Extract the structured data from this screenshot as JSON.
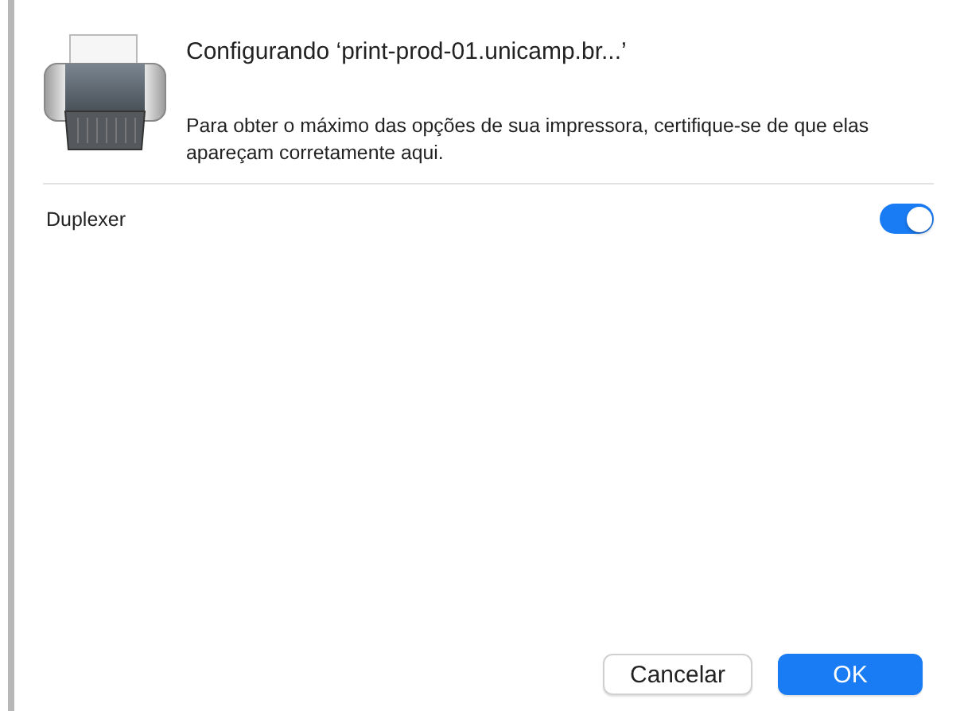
{
  "dialog": {
    "title": "Configurando ‘print-prod-01.unicamp.br...’",
    "description": "Para obter o máximo das opções de sua impressora, certifique-se de que elas apareçam corretamente aqui."
  },
  "options": [
    {
      "label": "Duplexer",
      "on": true
    }
  ],
  "buttons": [
    {
      "label": "Cancelar",
      "kind": "secondary"
    },
    {
      "label": "OK",
      "kind": "primary"
    }
  ]
}
